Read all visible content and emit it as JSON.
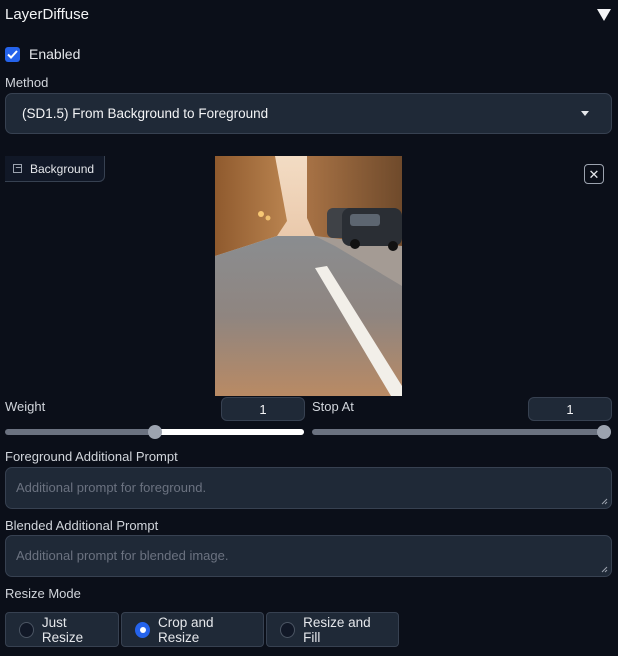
{
  "accordion": {
    "title": "LayerDiffuse",
    "collapse_icon": "triangle-down-icon"
  },
  "enabled": {
    "label": "Enabled",
    "checked": true
  },
  "method": {
    "label": "Method",
    "value": "(SD1.5) From Background to Foreground"
  },
  "background_image": {
    "label": "Background",
    "icon": "image-icon",
    "close_icon": "close-icon",
    "close_glyph": "✕"
  },
  "weight": {
    "label": "Weight",
    "value": "1",
    "min": 0,
    "max": 2,
    "current": 1
  },
  "stop_at": {
    "label": "Stop At",
    "value": "1",
    "min": 0,
    "max": 1,
    "current": 1
  },
  "foreground_prompt": {
    "label": "Foreground Additional Prompt",
    "placeholder": "Additional prompt for foreground."
  },
  "blended_prompt": {
    "label": "Blended Additional Prompt",
    "placeholder": "Additional prompt for blended image."
  },
  "resize_mode": {
    "label": "Resize Mode",
    "options": [
      {
        "label": "Just Resize",
        "selected": false
      },
      {
        "label": "Crop and Resize",
        "selected": true
      },
      {
        "label": "Resize and Fill",
        "selected": false
      }
    ]
  },
  "colors": {
    "accent": "#2563eb",
    "background": "#0b0f19",
    "input_bg": "#1f2937",
    "slider_fill": "#ffffff"
  }
}
